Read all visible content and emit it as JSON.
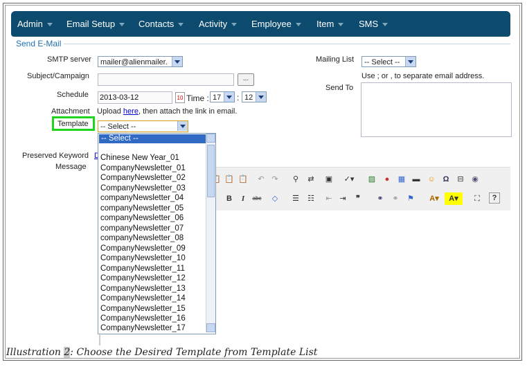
{
  "nav": {
    "items": [
      "Admin",
      "Email Setup",
      "Contacts",
      "Activity",
      "Employee",
      "Item",
      "SMS"
    ]
  },
  "section": {
    "legend": "Send E-Mail"
  },
  "form": {
    "smtp_label": "SMTP server",
    "smtp_value": "mailer@alienmailer.",
    "subject_label": "Subject/Campaign",
    "subject_button": "...",
    "schedule_label": "Schedule",
    "schedule_date": "2013-03-12",
    "time_label": "Time :",
    "time_hour": "17",
    "time_sep": ":",
    "time_min": "12",
    "attachment_label": "Attachment",
    "attachment_pre": "Upload ",
    "attachment_link": "here",
    "attachment_post": ", then attach the link in email.",
    "template_label": "Template",
    "template_value": "-- Select --",
    "preserved_label": "Preserved Keyword",
    "preserved_link_partial": "D",
    "message_label": "Message",
    "mailing_label": "Mailing List",
    "mailing_value": "-- Select --",
    "mailing_hint": "Use ; or , to separate email address.",
    "sendto_label": "Send To"
  },
  "template_dropdown": {
    "selected": "-- Select --",
    "options": [
      "",
      "Chinese New Year_01",
      "CompanyNewsletter_01",
      "CompanyNewsletter_02",
      "CompanyNewsletter_03",
      "companyNewsletter_04",
      "companyNewsletter_05",
      "companyNewsletter_06",
      "companyNewsletter_07",
      "companyNewsletter_08",
      "CompanyNewsletter_09",
      "CompanyNewsletter_10",
      "CompanyNewsletter_11",
      "CompanyNewsletter_12",
      "CompanyNewsletter_13",
      "CompanyNewsletter_14",
      "CompanyNewsletter_15",
      "CompanyNewsletter_16",
      "CompanyNewsletter_17"
    ]
  },
  "editor_toolbar": {
    "row1": [
      "paste-icon",
      "paste-text-icon",
      "paste-word-icon",
      "undo-icon",
      "redo-icon",
      "find-icon",
      "replace-icon",
      "select-all-icon",
      "spellcheck-icon",
      "image-icon",
      "flash-icon",
      "table-icon",
      "horizontal-rule-icon",
      "smiley-icon",
      "special-char-icon",
      "page-break-icon",
      "iframe-icon"
    ],
    "row2": [
      "bold-icon",
      "italic-icon",
      "strike-icon",
      "eraser-icon",
      "ordered-list-icon",
      "bullet-list-icon",
      "outdent-icon",
      "indent-icon",
      "blockquote-icon",
      "link-icon",
      "unlink-icon",
      "anchor-icon",
      "text-color-icon",
      "bg-color-icon",
      "maximize-icon",
      "help-icon"
    ],
    "labels": {
      "bold": "B",
      "italic": "I",
      "strike": "abc",
      "omega": "Ω",
      "quote": "❞",
      "help": "?",
      "textA": "A",
      "bgA": "A"
    }
  },
  "caption": {
    "prefix": "Illustration ",
    "number": "2",
    "text": ": Choose the Desired Template from Template List"
  }
}
